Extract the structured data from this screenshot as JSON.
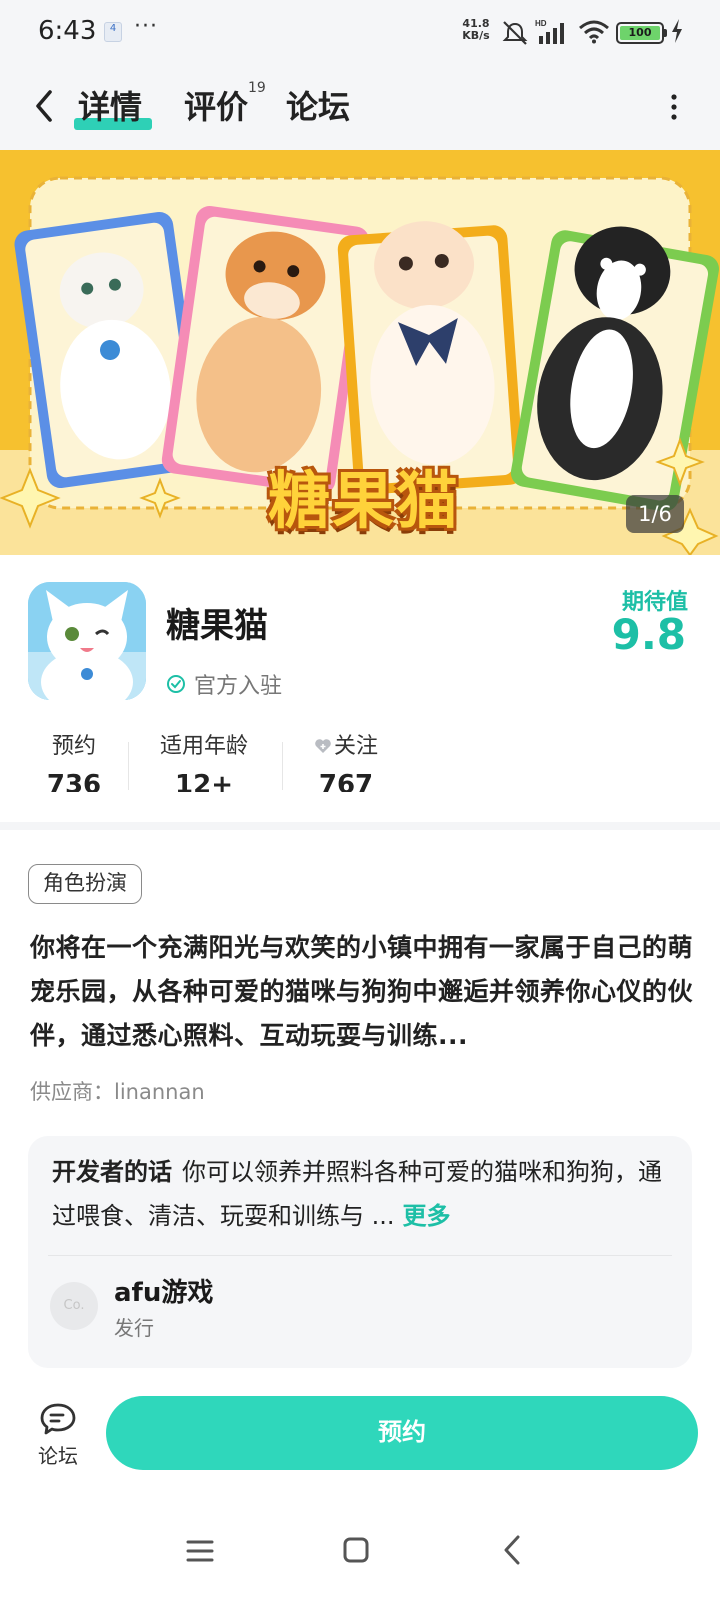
{
  "status_bar": {
    "time": "6:43",
    "notification_badge": "4",
    "more": "···",
    "network_speed_value": "41.8",
    "network_speed_unit": "KB/s",
    "signal_label": "HD",
    "battery": "100"
  },
  "nav": {
    "tabs": [
      {
        "label": "详情",
        "active": true
      },
      {
        "label": "评价",
        "count": "19"
      },
      {
        "label": "论坛"
      }
    ]
  },
  "banner": {
    "title": "糖果猫",
    "counter": "1/6"
  },
  "game": {
    "name": "糖果猫",
    "verified_text": "官方入驻",
    "expect_label": "期待值",
    "expect_value": "9.8"
  },
  "stats": [
    {
      "label": "预约",
      "value": "736"
    },
    {
      "label": "适用年龄",
      "value": "12+"
    },
    {
      "label": "关注",
      "value": "767"
    }
  ],
  "genre_tag": "角色扮演",
  "description": "你将在一个充满阳光与欢笑的小镇中拥有一家属于自己的萌宠乐园，从各种可爱的猫咪与狗狗中邂逅并领养你心仪的伙伴，通过悉心照料、互动玩耍与训练...",
  "supplier": "供应商：linannan",
  "developer": {
    "label": "开发者的话",
    "text": "你可以领养并照料各种可爱的猫咪和狗狗，通过喂食、清洁、玩耍和训练与 ...",
    "more": "更多",
    "publisher_avatar_text": "Co.",
    "publisher_name": "afu游戏",
    "publisher_role": "发行"
  },
  "bottom": {
    "forum_label": "论坛",
    "reserve_label": "预约"
  },
  "colors": {
    "accent": "#1dbfa6",
    "button": "#2fd7bb",
    "banner": "#f6c12f"
  }
}
